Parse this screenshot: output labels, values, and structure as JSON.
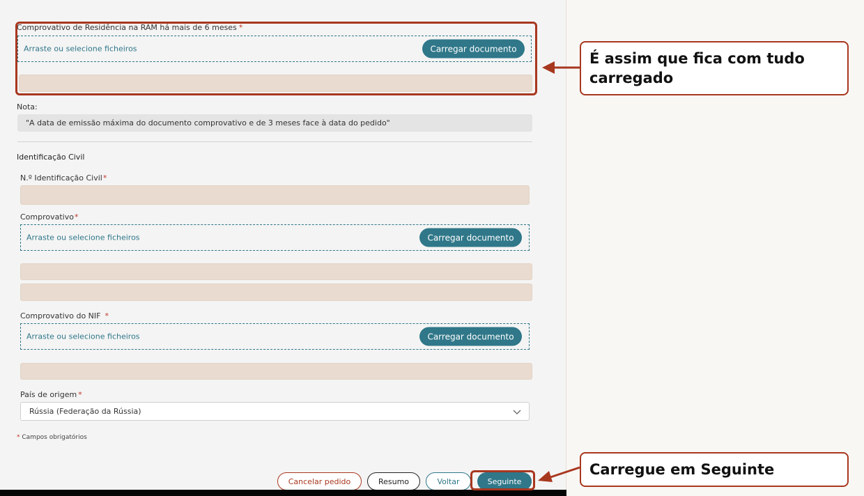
{
  "residence": {
    "label": "Comprovativo de Residência na RAM há mais de 6 meses",
    "required_mark": "*",
    "dropzone_text": "Arraste ou selecione ficheiros",
    "upload_label": "Carregar documento"
  },
  "note": {
    "label": "Nota:",
    "text": "\"A data de emissão máxima do documento comprovativo e de 3 meses face à data do pedido\""
  },
  "civil": {
    "section_title": "Identificação Civil",
    "id_label": "N.º Identificação Civil",
    "id_required": "*",
    "proof_label": "Comprovativo",
    "proof_required": "*",
    "dropzone_text": "Arraste ou selecione ficheiros",
    "upload_label": "Carregar documento"
  },
  "nif": {
    "label": "Comprovativo do NIF",
    "required_mark": "*",
    "dropzone_text": "Arraste ou selecione ficheiros",
    "upload_label": "Carregar documento"
  },
  "origin": {
    "label": "País de origem",
    "required_mark": "*",
    "selected_value": "Rússia (Federação da Rússia)"
  },
  "required_note": {
    "mark": "*",
    "text": "Campos obrigatórios"
  },
  "footer": {
    "cancel_label": "Cancelar pedido",
    "summary_label": "Resumo",
    "back_label": "Voltar",
    "next_label": "Seguinte"
  },
  "annotations": {
    "callout_top": "É assim que fica com tudo carregado",
    "callout_bottom": "Carregue em Seguinte"
  },
  "colors": {
    "accent": "#2f7789",
    "filled_field": "#e9dbd0",
    "annotation": "#a8371f",
    "cancel_text": "#a8371f"
  },
  "icons": {
    "select": "chevron-down-icon",
    "callout_arrow": "arrow-left-icon"
  }
}
